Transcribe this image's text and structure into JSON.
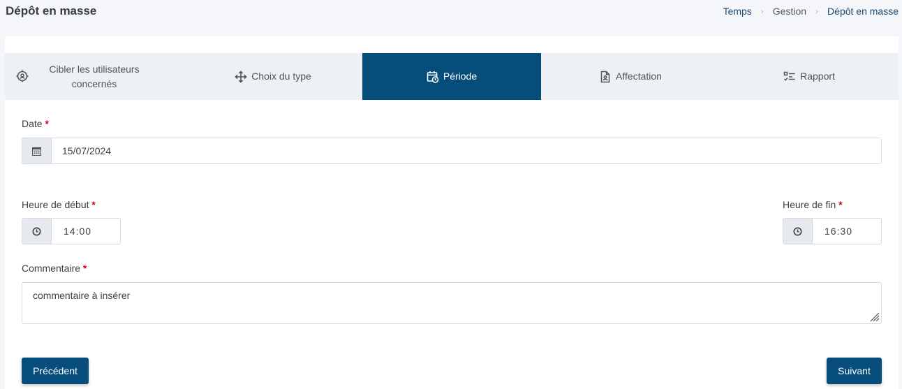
{
  "header": {
    "title": "Dépôt en masse",
    "breadcrumb": [
      "Temps",
      "Gestion",
      "Dépôt en masse"
    ]
  },
  "steps": [
    {
      "label": "Cibler les utilisateurs concernés",
      "icon": "crosshair-icon"
    },
    {
      "label": "Choix du type",
      "icon": "move-arrows-icon"
    },
    {
      "label": "Période",
      "icon": "calendar-clock-icon",
      "active": true
    },
    {
      "label": "Affectation",
      "icon": "document-user-icon"
    },
    {
      "label": "Rapport",
      "icon": "checklist-icon"
    }
  ],
  "form": {
    "date": {
      "label": "Date",
      "required": "*",
      "value": "15/07/2024"
    },
    "start": {
      "label": "Heure de début",
      "required": "*",
      "hours": "14",
      "minutes": "00"
    },
    "end": {
      "label": "Heure de fin",
      "required": "*",
      "hours": "16",
      "minutes": "30"
    },
    "comment": {
      "label": "Commentaire",
      "required": "*",
      "value": "commentaire à insérer"
    }
  },
  "buttons": {
    "previous": "Précédent",
    "next": "Suivant"
  },
  "colors": {
    "primary": "#064d7c",
    "required": "#d0021b",
    "link": "#1a4a75"
  }
}
